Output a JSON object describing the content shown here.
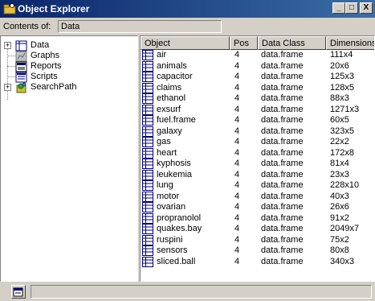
{
  "window": {
    "title": "Object Explorer",
    "controls": {
      "minimize": "_",
      "maximize": "□",
      "close": "X"
    }
  },
  "contents": {
    "label": "Contents of:",
    "value": "Data"
  },
  "tree": {
    "items": [
      {
        "label": "Data",
        "icon": "database-icon",
        "expandable": true
      },
      {
        "label": "Graphs",
        "icon": "graph-icon",
        "expandable": false
      },
      {
        "label": "Reports",
        "icon": "report-icon",
        "expandable": false
      },
      {
        "label": "Scripts",
        "icon": "script-icon",
        "expandable": false
      },
      {
        "label": "SearchPath",
        "icon": "searchpath-icon",
        "expandable": true
      }
    ]
  },
  "list": {
    "columns": [
      "Object",
      "Pos",
      "Data Class",
      "Dimensions"
    ],
    "rows": [
      {
        "name": "air",
        "pos": "4",
        "cls": "data.frame",
        "dim": "111x4"
      },
      {
        "name": "animals",
        "pos": "4",
        "cls": "data.frame",
        "dim": "20x6"
      },
      {
        "name": "capacitor",
        "pos": "4",
        "cls": "data.frame",
        "dim": "125x3"
      },
      {
        "name": "claims",
        "pos": "4",
        "cls": "data.frame",
        "dim": "128x5"
      },
      {
        "name": "ethanol",
        "pos": "4",
        "cls": "data.frame",
        "dim": "88x3"
      },
      {
        "name": "exsurf",
        "pos": "4",
        "cls": "data.frame",
        "dim": "1271x3"
      },
      {
        "name": "fuel.frame",
        "pos": "4",
        "cls": "data.frame",
        "dim": "60x5"
      },
      {
        "name": "galaxy",
        "pos": "4",
        "cls": "data.frame",
        "dim": "323x5"
      },
      {
        "name": "gas",
        "pos": "4",
        "cls": "data.frame",
        "dim": "22x2"
      },
      {
        "name": "heart",
        "pos": "4",
        "cls": "data.frame",
        "dim": "172x8"
      },
      {
        "name": "kyphosis",
        "pos": "4",
        "cls": "data.frame",
        "dim": "81x4"
      },
      {
        "name": "leukemia",
        "pos": "4",
        "cls": "data.frame",
        "dim": "23x3"
      },
      {
        "name": "lung",
        "pos": "4",
        "cls": "data.frame",
        "dim": "228x10"
      },
      {
        "name": "motor",
        "pos": "4",
        "cls": "data.frame",
        "dim": "40x3"
      },
      {
        "name": "ovarian",
        "pos": "4",
        "cls": "data.frame",
        "dim": "26x6"
      },
      {
        "name": "propranolol",
        "pos": "4",
        "cls": "data.frame",
        "dim": "91x2"
      },
      {
        "name": "quakes.bay",
        "pos": "4",
        "cls": "data.frame",
        "dim": "2049x7"
      },
      {
        "name": "ruspini",
        "pos": "4",
        "cls": "data.frame",
        "dim": "75x2"
      },
      {
        "name": "sensors",
        "pos": "4",
        "cls": "data.frame",
        "dim": "80x8"
      },
      {
        "name": "sliced.ball",
        "pos": "4",
        "cls": "data.frame",
        "dim": "340x3"
      }
    ]
  },
  "colors": {
    "titlebar_start": "#0a246a",
    "titlebar_end": "#3a6ea5",
    "face": "#d4d0c8"
  }
}
